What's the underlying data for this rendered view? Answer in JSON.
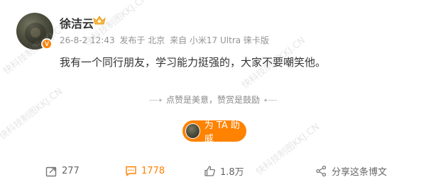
{
  "post": {
    "username": "徐洁云",
    "verified_badge": "V",
    "meta": {
      "time": "26-8-2 12:43",
      "location": "发布于 北京",
      "source": "来自 小米17 Ultra 徕卡版"
    },
    "content": "我有一个同行朋友，学习能力挺强的，大家不要嘲笑他。",
    "reward_hint": "点赞是美意，赞赏是鼓励",
    "reward_button": "为 TA 助威"
  },
  "actions": {
    "forward_count": "277",
    "comment_count": "1778",
    "like_count": "1.8万",
    "share_label": "分享这条博文"
  },
  "watermark_text": "快科技制图KKJ.CN",
  "icons": {
    "forward": "forward-icon",
    "comment": "comment-icon",
    "like": "like-icon",
    "share": "share-icon",
    "crown": "crown-badge-icon"
  },
  "colors": {
    "accent": "#ff8200",
    "text": "#333333",
    "meta": "#939393"
  }
}
